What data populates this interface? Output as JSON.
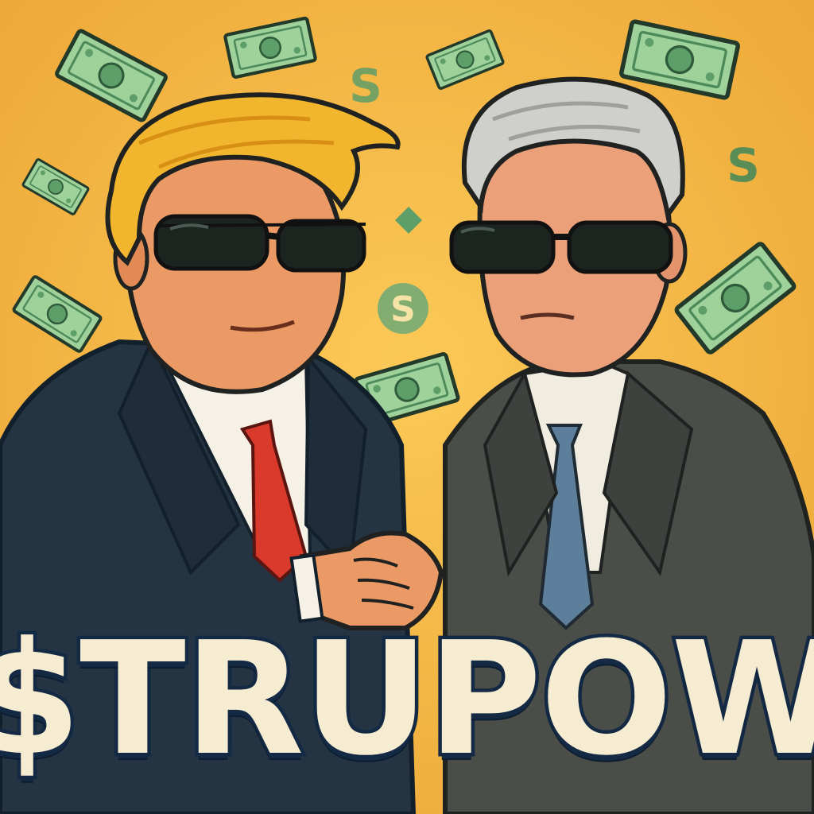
{
  "title_text": "$TRUPOW",
  "icons": {
    "background": "yellow-background-icon",
    "banknote": "banknote-icon",
    "dollar_coin": "dollar-coin-icon",
    "left_figure": "blond-man-in-suit-icon",
    "right_figure": "grey-haired-man-in-suit-icon",
    "handshake": "handshake-icon"
  },
  "colors": {
    "background": "#f3b53e",
    "money_green": "#8cc48a",
    "money_dark": "#3f7a4e",
    "left_suit": "#253443",
    "right_suit": "#4a4d48",
    "left_tie": "#d93a2b",
    "right_tie": "#5d7f9b",
    "hair_blond": "#f2b62e",
    "hair_grey": "#cfd0cc",
    "skin": "#eb9a65",
    "text_fill": "#f6ecd2",
    "text_outline": "#142a44"
  }
}
